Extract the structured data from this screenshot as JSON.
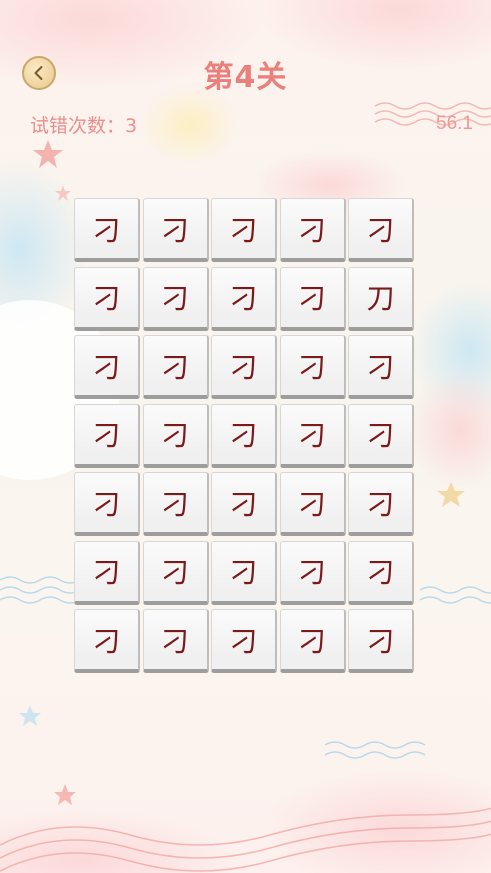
{
  "header": {
    "back_icon": "chevron-left-icon",
    "title": "第4关",
    "tries_label": "试错次数：3",
    "timer": "56.1"
  },
  "colors": {
    "title": "#ea7f7b",
    "tile_char": "#7b1a1a"
  },
  "board": {
    "rows": 7,
    "cols": 5,
    "cells": [
      [
        "刁",
        "刁",
        "刁",
        "刁",
        "刁"
      ],
      [
        "刁",
        "刁",
        "刁",
        "刁",
        "刀"
      ],
      [
        "刁",
        "刁",
        "刁",
        "刁",
        "刁"
      ],
      [
        "刁",
        "刁",
        "刁",
        "刁",
        "刁"
      ],
      [
        "刁",
        "刁",
        "刁",
        "刁",
        "刁"
      ],
      [
        "刁",
        "刁",
        "刁",
        "刁",
        "刁"
      ],
      [
        "刁",
        "刁",
        "刁",
        "刁",
        "刁"
      ]
    ]
  }
}
